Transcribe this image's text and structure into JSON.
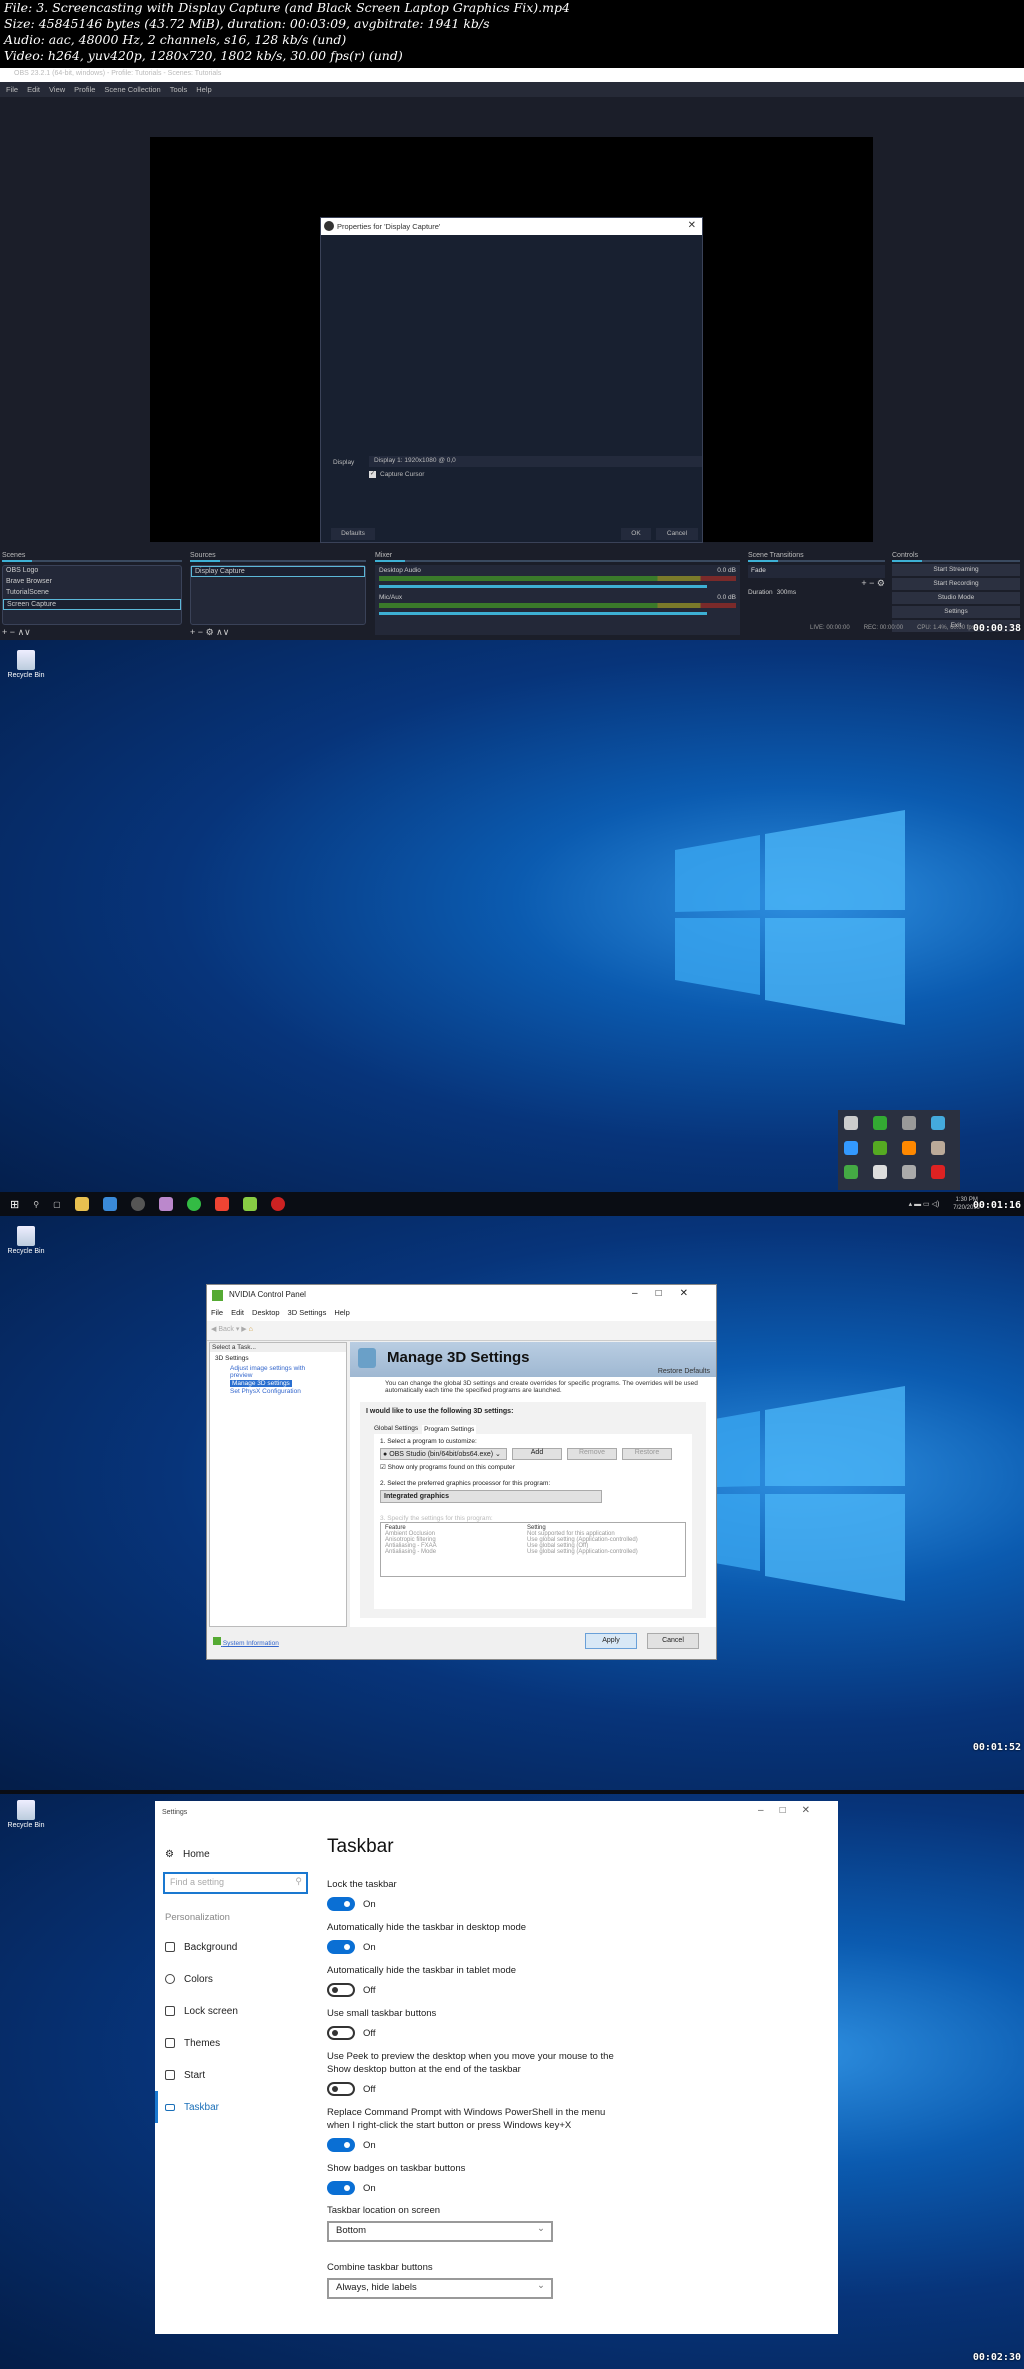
{
  "file_info": {
    "line1": "File: 3. Screencasting with Display Capture (and Black Screen Laptop Graphics Fix).mp4",
    "line2": "Size: 45845146 bytes (43.72 MiB), duration: 00:03:09, avgbitrate: 1941 kb/s",
    "line3": "Audio: aac, 48000 Hz, 2 channels, s16, 128 kb/s (und)",
    "line4": "Video: h264, yuv420p, 1280x720, 1802 kb/s, 30.00 fps(r) (und)"
  },
  "frame1": {
    "timestamp": "00:00:38",
    "window_title": "OBS 23.2.1 (64-bit, windows) - Profile: Tutorials - Scenes: Tutorials",
    "menu": [
      "File",
      "Edit",
      "View",
      "Profile",
      "Scene Collection",
      "Tools",
      "Help"
    ],
    "dialog": {
      "title": "Properties for 'Display Capture'",
      "display_label": "Display",
      "display_value": "Display 1: 1920x1080 @ 0,0",
      "capture_cursor": "Capture Cursor",
      "defaults": "Defaults",
      "ok": "OK",
      "cancel": "Cancel"
    },
    "scenes": {
      "title": "Scenes",
      "items": [
        "OBS Logo",
        "Brave Browser",
        "TutorialScene",
        "Screen Capture"
      ]
    },
    "sources": {
      "title": "Sources",
      "items": [
        "Display Capture"
      ]
    },
    "mixer": {
      "title": "Mixer",
      "channels": [
        {
          "name": "Desktop Audio",
          "db": "0.0 dB"
        },
        {
          "name": "Mic/Aux",
          "db": "0.0 dB"
        }
      ]
    },
    "transitions": {
      "title": "Scene Transitions",
      "value": "Fade",
      "duration_label": "Duration",
      "duration": "300ms"
    },
    "controls": {
      "title": "Controls",
      "buttons": [
        "Start Streaming",
        "Start Recording",
        "Studio Mode",
        "Settings",
        "Exit"
      ]
    },
    "status": {
      "live": "LIVE: 00:00:00",
      "rec": "REC: 00:00:00",
      "cpu": "CPU: 1.4%, 60.00 fps"
    }
  },
  "desktop": {
    "recycle_bin": "Recycle Bin"
  },
  "frame2": {
    "timestamp": "00:01:16",
    "clock_time": "1:30 PM",
    "clock_date": "7/20/2019"
  },
  "frame3": {
    "timestamp": "00:01:52",
    "title": "NVIDIA Control Panel",
    "menu": [
      "File",
      "Edit",
      "Desktop",
      "3D Settings",
      "Help"
    ],
    "back": "Back",
    "select_task": "Select a Task...",
    "tree": {
      "root": "3D Settings",
      "items": [
        "Adjust image settings with preview",
        "Manage 3D settings",
        "Set PhysX Configuration"
      ]
    },
    "heading": "Manage 3D Settings",
    "restore": "Restore Defaults",
    "description": "You can change the global 3D settings and create overrides for specific programs. The overrides will be used automatically each time the specified programs are launched.",
    "prompt": "I would like to use the following 3D settings:",
    "tabs": [
      "Global Settings",
      "Program Settings"
    ],
    "step1": "1. Select a program to customize:",
    "program": "OBS Studio (bin/64bit/obs64.exe)",
    "add": "Add",
    "remove": "Remove",
    "restore_btn": "Restore",
    "show_only": "Show only programs found on this computer",
    "step2": "2. Select the preferred graphics processor for this program:",
    "gpu": "Integrated graphics",
    "step3": "3. Specify the settings for this program:",
    "table": {
      "headers": [
        "Feature",
        "Setting"
      ],
      "rows": [
        [
          "Ambient Occlusion",
          "Not supported for this application"
        ],
        [
          "Anisotropic filtering",
          "Use global setting (Application-controlled)"
        ],
        [
          "Antialiasing - FXAA",
          "Use global setting (Off)"
        ],
        [
          "Antialiasing - Mode",
          "Use global setting (Application-controlled)"
        ]
      ]
    },
    "system_info": "System Information",
    "apply": "Apply",
    "cancel": "Cancel"
  },
  "frame4": {
    "timestamp": "00:02:30",
    "window_title": "Settings",
    "home": "Home",
    "search_placeholder": "Find a setting",
    "section": "Personalization",
    "nav": [
      "Background",
      "Colors",
      "Lock screen",
      "Themes",
      "Start",
      "Taskbar"
    ],
    "heading": "Taskbar",
    "toggles": [
      {
        "label": "Lock the taskbar",
        "state": "On",
        "on": true
      },
      {
        "label": "Automatically hide the taskbar in desktop mode",
        "state": "On",
        "on": true
      },
      {
        "label": "Automatically hide the taskbar in tablet mode",
        "state": "Off",
        "on": false
      },
      {
        "label": "Use small taskbar buttons",
        "state": "Off",
        "on": false
      },
      {
        "label": "Use Peek to preview the desktop when you move your mouse to the Show desktop button at the end of the taskbar",
        "state": "Off",
        "on": false
      },
      {
        "label": "Replace Command Prompt with Windows PowerShell in the menu when I right-click the start button or press Windows key+X",
        "state": "On",
        "on": true
      },
      {
        "label": "Show badges on taskbar buttons",
        "state": "On",
        "on": true
      }
    ],
    "location_label": "Taskbar location on screen",
    "location": "Bottom",
    "combine_label": "Combine taskbar buttons",
    "combine": "Always, hide labels"
  }
}
